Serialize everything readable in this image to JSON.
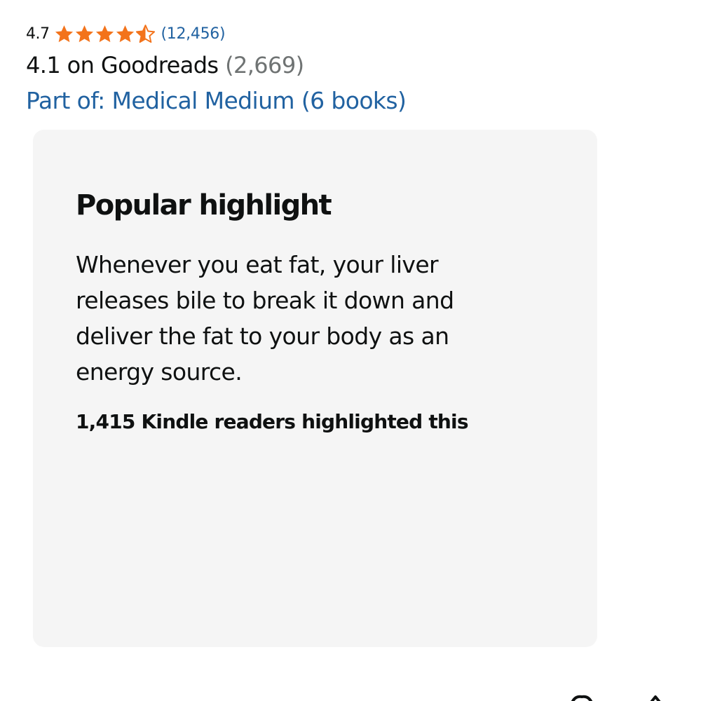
{
  "rating": {
    "value": "4.7",
    "stars": 4.7,
    "count": "(12,456)",
    "star_color": "#f3731b"
  },
  "goodreads": {
    "text": "4.1 on Goodreads",
    "count": "(2,669)"
  },
  "series": {
    "link_text": "Part of: Medical Medium (6 books)",
    "link_color": "#2162a1"
  },
  "highlight": {
    "heading": "Popular highlight",
    "quote": "Whenever you eat fat, your liver releases bile to break it down and deliver the fat to your body as an energy source.",
    "readers_text": "1,415 Kindle readers highlighted this",
    "card_bg": "#f5f5f5"
  },
  "bottom_icons": [
    "partial-icon",
    "partial-icon"
  ]
}
